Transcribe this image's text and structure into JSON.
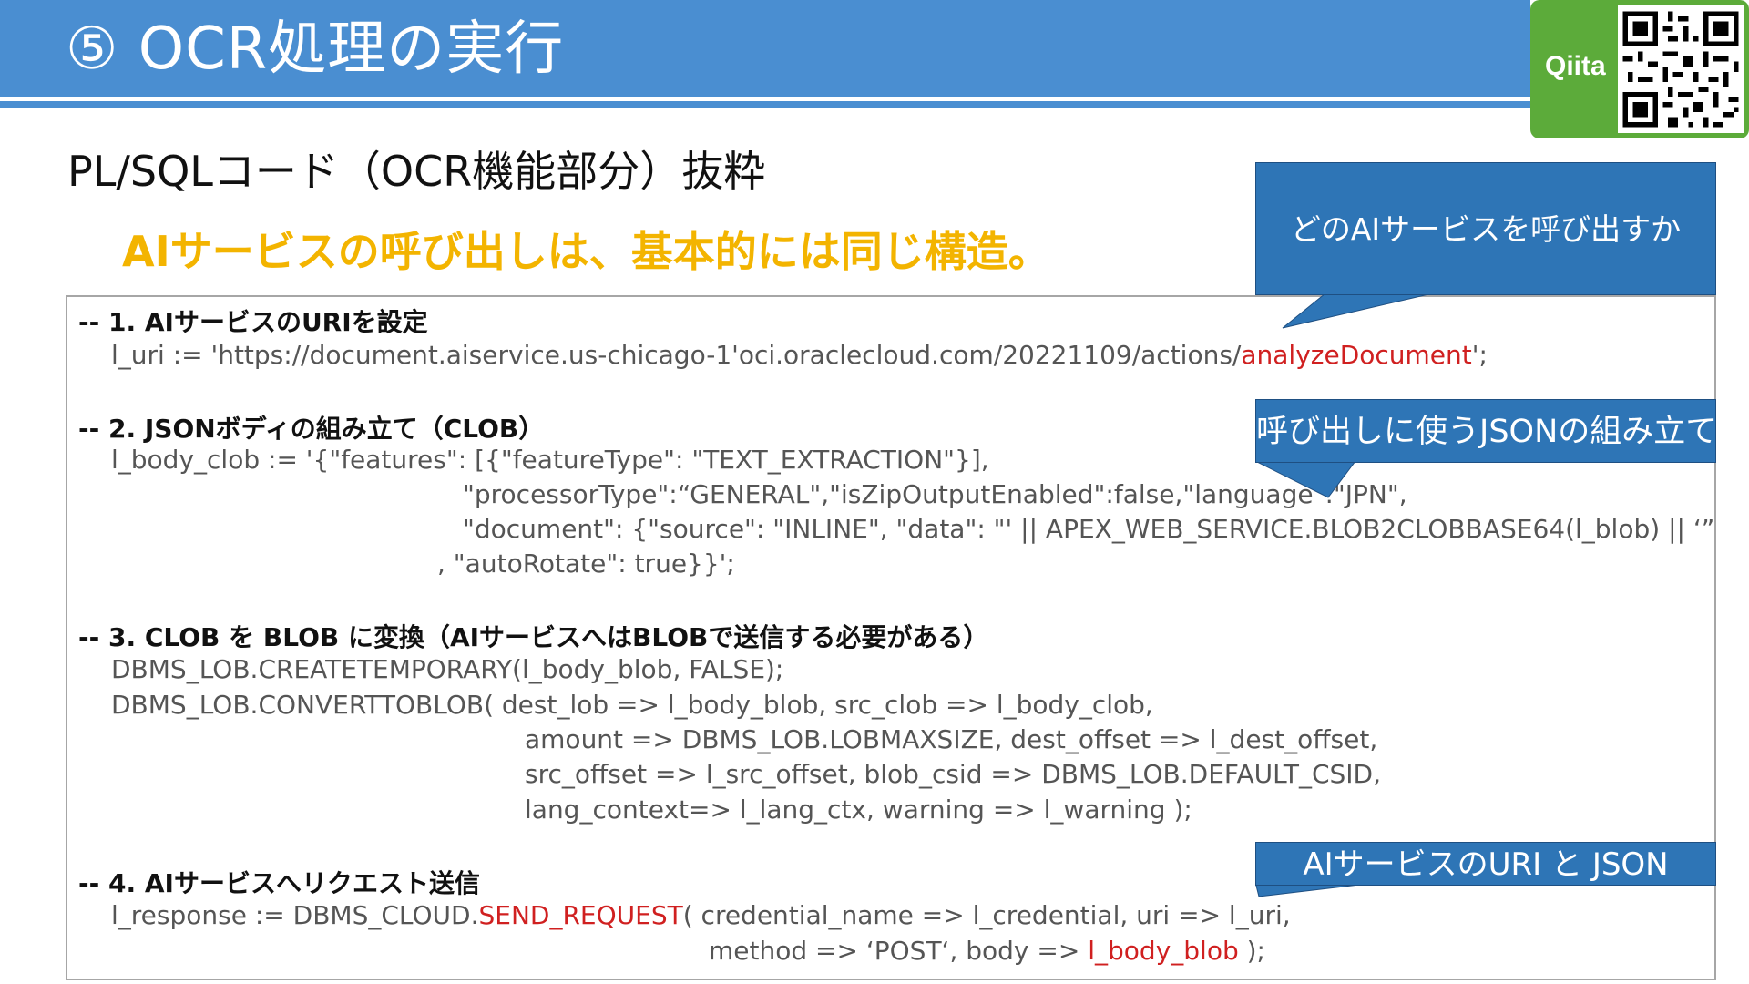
{
  "header": {
    "title": "⑤ OCR処理の実行",
    "badge_label": "Qiita"
  },
  "subtitle": "PL/SQLコード（OCR機能部分）抜粋",
  "highlight": "AIサービスの呼び出しは、基本的には同じ構造。",
  "callouts": {
    "which_service": "どのAIサービスを呼び出すか",
    "json_build": "呼び出しに使うJSONの組み立て",
    "uri_json": "AIサービスのURI と JSON"
  },
  "code": {
    "s1_header": "-- 1. AIサービスのURIを設定",
    "s1_line_a": "l_uri := 'https://document.aiservice.us-chicago-1'oci.oraclecloud.com/20221109/actions/",
    "s1_line_red": "analyzeDocument",
    "s1_line_b": "';",
    "s2_header": "-- 2. JSONボディの組み立て（CLOB）",
    "s2_l1": "l_body_clob := '{\"features\": [{\"featureType\": \"TEXT_EXTRACTION\"}],",
    "s2_l2": "\"processorType\":“GENERAL\",\"isZipOutputEnabled\":false,\"language\":\"JPN\",",
    "s2_l3": "\"document\": {\"source\": \"INLINE\", \"data\": \"'  || APEX_WEB_SERVICE.BLOB2CLOBBASE64(l_blob) || ‘”",
    "s2_l4": ",  \"autoRotate\": true}}';",
    "s3_header": "-- 3. CLOB を BLOB に変換（AIサービスへはBLOBで送信する必要がある）",
    "s3_l1": "DBMS_LOB.CREATETEMPORARY(l_body_blob, FALSE);",
    "s3_l2": "DBMS_LOB.CONVERTTOBLOB(     dest_lob      => l_body_blob,    src_clob       => l_body_clob,",
    "s3_l3": "amount        =>    DBMS_LOB.LOBMAXSIZE,             dest_offset => l_dest_offset,",
    "s3_l4": "src_offset   => l_src_offset,     blob_csid     => DBMS_LOB.DEFAULT_CSID,",
    "s3_l5": "lang_context=> l_lang_ctx,      warning      => l_warning    );",
    "s4_header": "-- 4. AIサービスへリクエスト送信",
    "s4_l1_a": "l_response := DBMS_CLOUD.",
    "s4_l1_red": "SEND_REQUEST",
    "s4_l1_b": "(  credential_name => l_credential,       uri              => l_uri,",
    "s4_l2_a": "method          => ‘POST‘,                  body            => ",
    "s4_l2_red": "l_body_blob",
    "s4_l2_b": "     );"
  }
}
